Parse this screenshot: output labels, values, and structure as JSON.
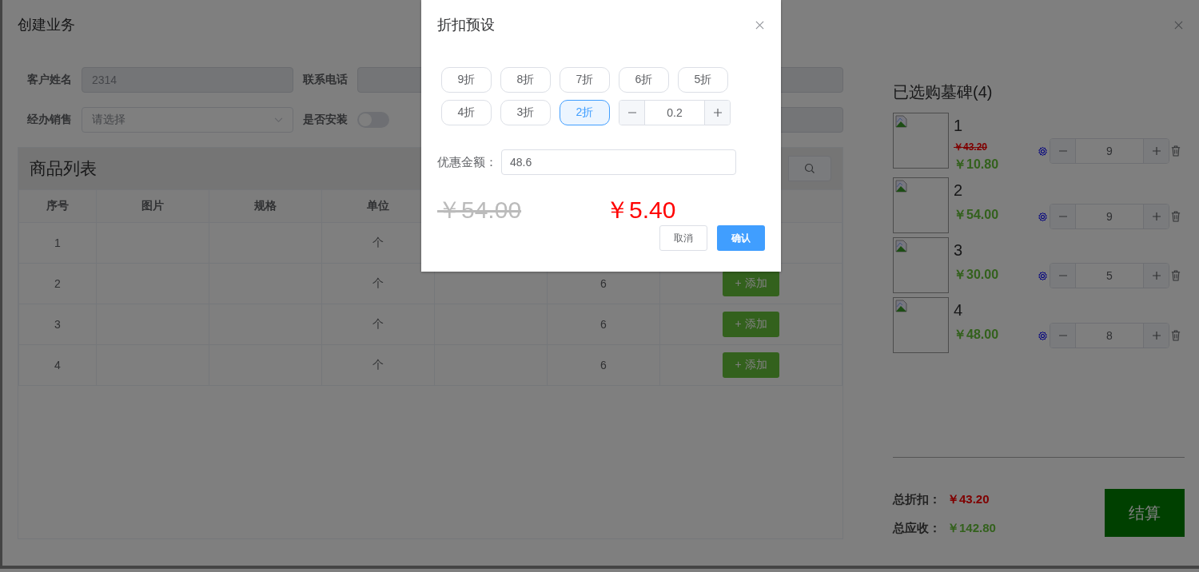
{
  "drawer": {
    "title": "创建业务"
  },
  "form": {
    "rows": [
      [
        {
          "kind": "input",
          "label": "客户姓名",
          "value": "2314"
        },
        {
          "kind": "input",
          "label": "联系电话"
        }
      ],
      [
        {
          "kind": "select",
          "label": "经办销售",
          "placeholder": "请选择"
        },
        {
          "kind": "switch",
          "label": "是否安装",
          "on": false
        },
        {
          "kind": "input"
        }
      ]
    ]
  },
  "product_list": {
    "title": "商品列表",
    "columns": [
      "序号",
      "图片",
      "规格",
      "单位"
    ],
    "rows": [
      {
        "index": "1",
        "unit": "个"
      },
      {
        "index": "2",
        "unit": "个",
        "column_6": "6",
        "action": "+ 添加"
      },
      {
        "index": "3",
        "unit": "个",
        "column_6": "6",
        "action": "+ 添加"
      },
      {
        "index": "4",
        "unit": "个",
        "column_6": "6",
        "action": "+ 添加"
      }
    ]
  },
  "cart": {
    "title": "已选购墓碑(4)",
    "items": [
      {
        "name": "1",
        "original_price": "￥43.20",
        "price": "￥10.80",
        "quantity": "9"
      },
      {
        "name": "2",
        "price": "￥54.00",
        "quantity": "9"
      },
      {
        "name": "3",
        "price": "￥30.00",
        "quantity": "5"
      },
      {
        "name": "4",
        "price": "￥48.00",
        "quantity": "8"
      }
    ],
    "totals": [
      {
        "label": "总折扣：",
        "value": "￥43.20",
        "kind": "discount"
      },
      {
        "label": "总应收：",
        "value": "￥142.80",
        "kind": "receivable"
      }
    ],
    "checkout": "结算"
  },
  "dialog": {
    "title": "折扣预设",
    "options": [
      {
        "label": "9折",
        "selected": false
      },
      {
        "label": "8折",
        "selected": false
      },
      {
        "label": "7折",
        "selected": false
      },
      {
        "label": "6折",
        "selected": false
      },
      {
        "label": "5折",
        "selected": false
      },
      {
        "label": "4折",
        "selected": false
      },
      {
        "label": "3折",
        "selected": false
      },
      {
        "label": "2折",
        "selected": true
      }
    ],
    "rate": "0.2",
    "amount_label": "优惠金额：",
    "amount": "48.6",
    "original_price": "￥54.00",
    "final_price": "￥5.40",
    "cancel": "取消",
    "confirm": "确认"
  }
}
